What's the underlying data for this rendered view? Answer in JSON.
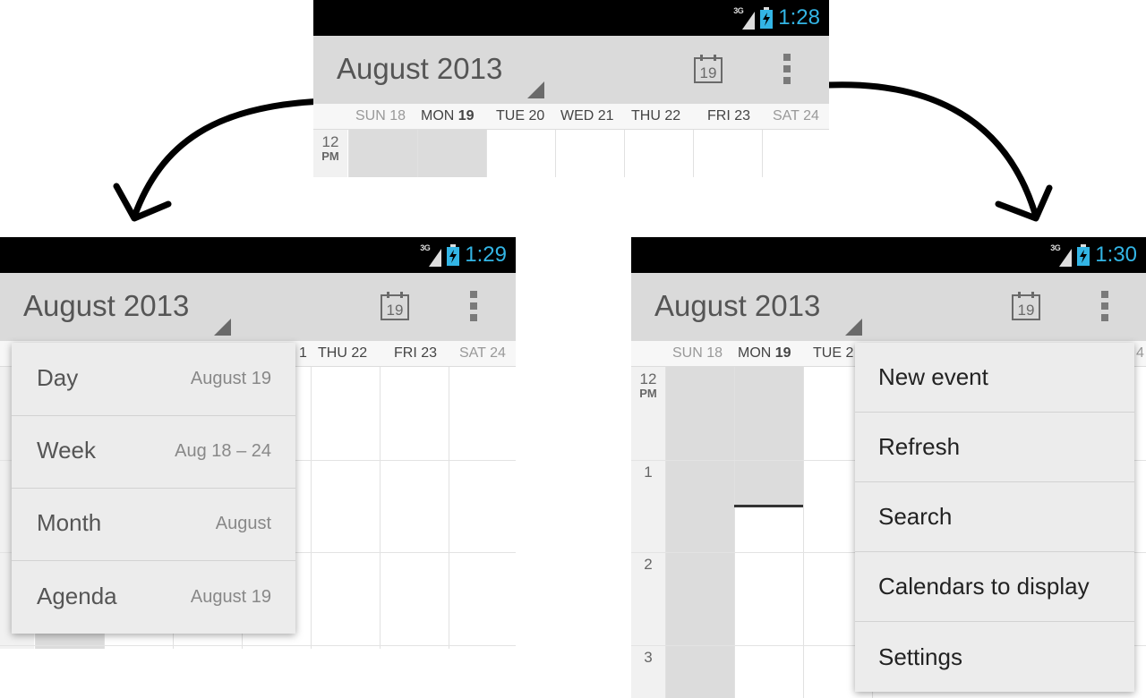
{
  "status": {
    "network": "3G",
    "times": [
      "1:28",
      "1:29",
      "1:30"
    ]
  },
  "calendar": {
    "title": "August 2013",
    "today_icon_day": "19"
  },
  "days": [
    {
      "name": "SUN",
      "num": "18"
    },
    {
      "name": "MON",
      "num": "19"
    },
    {
      "name": "TUE",
      "num": "20"
    },
    {
      "name": "WED",
      "num": "21"
    },
    {
      "name": "THU",
      "num": "22"
    },
    {
      "name": "FRI",
      "num": "23"
    },
    {
      "name": "SAT",
      "num": "24"
    }
  ],
  "left_days": [
    {
      "label": "1"
    },
    {
      "label": "THU 22"
    },
    {
      "label": "FRI 23"
    },
    {
      "label": "SAT 24"
    }
  ],
  "right_days": [
    {
      "label": "TUE 2"
    },
    {
      "label": "4"
    }
  ],
  "time_labels": {
    "noon_hour": "12",
    "noon_ampm": "PM",
    "hours": [
      "1",
      "2",
      "3"
    ]
  },
  "view_menu": [
    {
      "label": "Day",
      "sub": "August 19"
    },
    {
      "label": "Week",
      "sub": "Aug 18 – 24"
    },
    {
      "label": "Month",
      "sub": "August"
    },
    {
      "label": "Agenda",
      "sub": "August 19"
    }
  ],
  "overflow_menu": [
    {
      "label": "New event"
    },
    {
      "label": "Refresh"
    },
    {
      "label": "Search"
    },
    {
      "label": "Calendars to display"
    },
    {
      "label": "Settings"
    }
  ],
  "colors": {
    "clock": "#33b5e5",
    "battery": "#33b5e5",
    "actionbar": "#dadada",
    "arrow": "#000000"
  },
  "icons": [
    "signal-icon",
    "battery-charging-icon",
    "today-calendar-icon",
    "overflow-menu-icon",
    "dropdown-triangle-icon",
    "arrow-left-icon",
    "arrow-right-icon"
  ]
}
